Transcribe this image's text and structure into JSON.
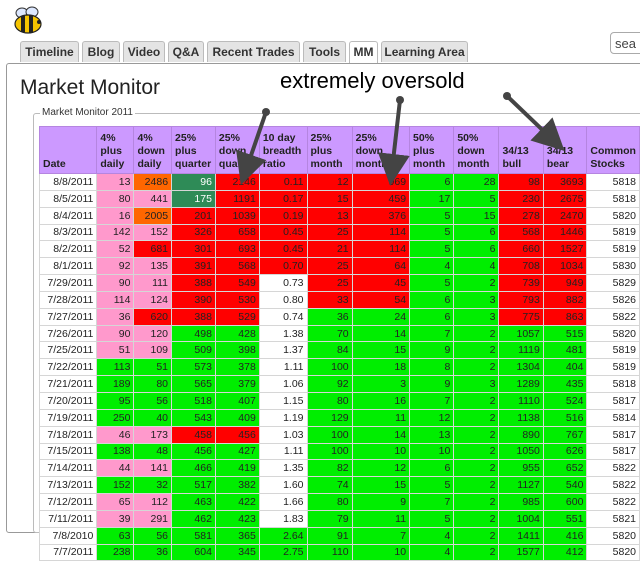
{
  "search": {
    "placeholder": "sea"
  },
  "tabs": [
    "Timeline",
    "Blog",
    "Video",
    "Q&A",
    "Recent Trades",
    "Tools",
    "MM",
    "Learning Area"
  ],
  "active_tab": "MM",
  "page_title": "Market Monitor",
  "section_legend": "Market Monitor 2011",
  "annotation": "extremely oversold",
  "columns": [
    "Date",
    "4% plus daily",
    "4% down daily",
    "25% plus quarter",
    "25% down quarter",
    "10 day breadth ratio",
    "25% plus month",
    "25% down month",
    "50% plus month",
    "50% down month",
    "34/13 bull",
    "34/13 bear",
    "Common Stocks"
  ],
  "colors": {
    "green": "#00ee00",
    "red": "#ff0000",
    "pink": "#ff99cc",
    "orange": "#ff6600",
    "dark_green": "#2e8b57",
    "header": "#cc99ff"
  },
  "rows": [
    {
      "v": [
        "8/8/2011",
        "13",
        "2486",
        "96",
        "2146",
        "0.11",
        "12",
        "969",
        "6",
        "28",
        "98",
        "3693",
        "5818"
      ],
      "c": "WPODRRRRGGRRW"
    },
    {
      "v": [
        "8/5/2011",
        "80",
        "441",
        "175",
        "1191",
        "0.17",
        "15",
        "459",
        "17",
        "5",
        "230",
        "2675",
        "5818"
      ],
      "c": "WPPDRRRRGGRRW"
    },
    {
      "v": [
        "8/4/2011",
        "16",
        "2005",
        "201",
        "1039",
        "0.19",
        "13",
        "376",
        "5",
        "15",
        "278",
        "2470",
        "5820"
      ],
      "c": "WPORRRRRGGRRW"
    },
    {
      "v": [
        "8/3/2011",
        "142",
        "152",
        "326",
        "658",
        "0.45",
        "25",
        "114",
        "5",
        "6",
        "568",
        "1446",
        "5819"
      ],
      "c": "WPPRRRRRGGRRW"
    },
    {
      "v": [
        "8/2/2011",
        "52",
        "681",
        "301",
        "693",
        "0.45",
        "21",
        "114",
        "5",
        "6",
        "660",
        "1527",
        "5819"
      ],
      "c": "WPRRRRRRGGRRW"
    },
    {
      "v": [
        "8/1/2011",
        "92",
        "135",
        "391",
        "568",
        "0.70",
        "25",
        "64",
        "4",
        "4",
        "708",
        "1034",
        "5830"
      ],
      "c": "WPPRRRRRGGRRW"
    },
    {
      "v": [
        "7/29/2011",
        "90",
        "111",
        "388",
        "549",
        "0.73",
        "25",
        "45",
        "5",
        "2",
        "739",
        "949",
        "5829"
      ],
      "c": "WPPRRWRRGGRRW"
    },
    {
      "v": [
        "7/28/2011",
        "114",
        "124",
        "390",
        "530",
        "0.80",
        "33",
        "54",
        "6",
        "3",
        "793",
        "882",
        "5826"
      ],
      "c": "WPPRRWRRGGRRW"
    },
    {
      "v": [
        "7/27/2011",
        "36",
        "620",
        "388",
        "529",
        "0.74",
        "36",
        "24",
        "6",
        "3",
        "775",
        "863",
        "5822"
      ],
      "c": "WPRRRWGGGGRRW"
    },
    {
      "v": [
        "7/26/2011",
        "90",
        "120",
        "498",
        "428",
        "1.38",
        "70",
        "14",
        "7",
        "2",
        "1057",
        "515",
        "5820"
      ],
      "c": "WPPGGWGGGGGGW"
    },
    {
      "v": [
        "7/25/2011",
        "51",
        "109",
        "509",
        "398",
        "1.37",
        "84",
        "15",
        "9",
        "2",
        "1119",
        "481",
        "5819"
      ],
      "c": "WPPGGWGGGGGGW"
    },
    {
      "v": [
        "7/22/2011",
        "113",
        "51",
        "573",
        "378",
        "1.11",
        "100",
        "18",
        "8",
        "2",
        "1304",
        "404",
        "5819"
      ],
      "c": "WGGGGWGGGGGGW"
    },
    {
      "v": [
        "7/21/2011",
        "189",
        "80",
        "565",
        "379",
        "1.06",
        "92",
        "3",
        "9",
        "3",
        "1289",
        "435",
        "5818"
      ],
      "c": "WGGGGWGGGGGGW"
    },
    {
      "v": [
        "7/20/2011",
        "95",
        "56",
        "518",
        "407",
        "1.15",
        "80",
        "16",
        "7",
        "2",
        "1110",
        "524",
        "5817"
      ],
      "c": "WGGGGWGGGGGGW"
    },
    {
      "v": [
        "7/19/2011",
        "250",
        "40",
        "543",
        "409",
        "1.19",
        "129",
        "11",
        "12",
        "2",
        "1138",
        "516",
        "5814"
      ],
      "c": "WGGGGWGGGGGGW"
    },
    {
      "v": [
        "7/18/2011",
        "46",
        "173",
        "458",
        "456",
        "1.03",
        "100",
        "14",
        "13",
        "2",
        "890",
        "767",
        "5817"
      ],
      "c": "WPPRRWGGGGGGW"
    },
    {
      "v": [
        "7/15/2011",
        "138",
        "48",
        "456",
        "427",
        "1.11",
        "100",
        "10",
        "10",
        "2",
        "1050",
        "626",
        "5817"
      ],
      "c": "WGGGGWGGGGGGW"
    },
    {
      "v": [
        "7/14/2011",
        "44",
        "141",
        "466",
        "419",
        "1.35",
        "82",
        "12",
        "6",
        "2",
        "955",
        "652",
        "5822"
      ],
      "c": "WPPGGWGGGGGGW"
    },
    {
      "v": [
        "7/13/2011",
        "152",
        "32",
        "517",
        "382",
        "1.60",
        "74",
        "15",
        "5",
        "2",
        "1127",
        "540",
        "5822"
      ],
      "c": "WGGGGWGGGGGGW"
    },
    {
      "v": [
        "7/12/2011",
        "65",
        "112",
        "463",
        "422",
        "1.66",
        "80",
        "9",
        "7",
        "2",
        "985",
        "600",
        "5822"
      ],
      "c": "WPPGGWGGGGGGW"
    },
    {
      "v": [
        "7/11/2011",
        "39",
        "291",
        "462",
        "423",
        "1.83",
        "79",
        "11",
        "5",
        "2",
        "1004",
        "551",
        "5821"
      ],
      "c": "WPPGGWGGGGGGW"
    },
    {
      "v": [
        "7/8/2010",
        "63",
        "56",
        "581",
        "365",
        "2.64",
        "91",
        "7",
        "4",
        "2",
        "1411",
        "416",
        "5820"
      ],
      "c": "WGGGGGGGGGGGW"
    },
    {
      "v": [
        "7/7/2011",
        "238",
        "36",
        "604",
        "345",
        "2.75",
        "110",
        "10",
        "4",
        "2",
        "1577",
        "412",
        "5820"
      ],
      "c": "WGGGGGGGGGGGW"
    }
  ]
}
